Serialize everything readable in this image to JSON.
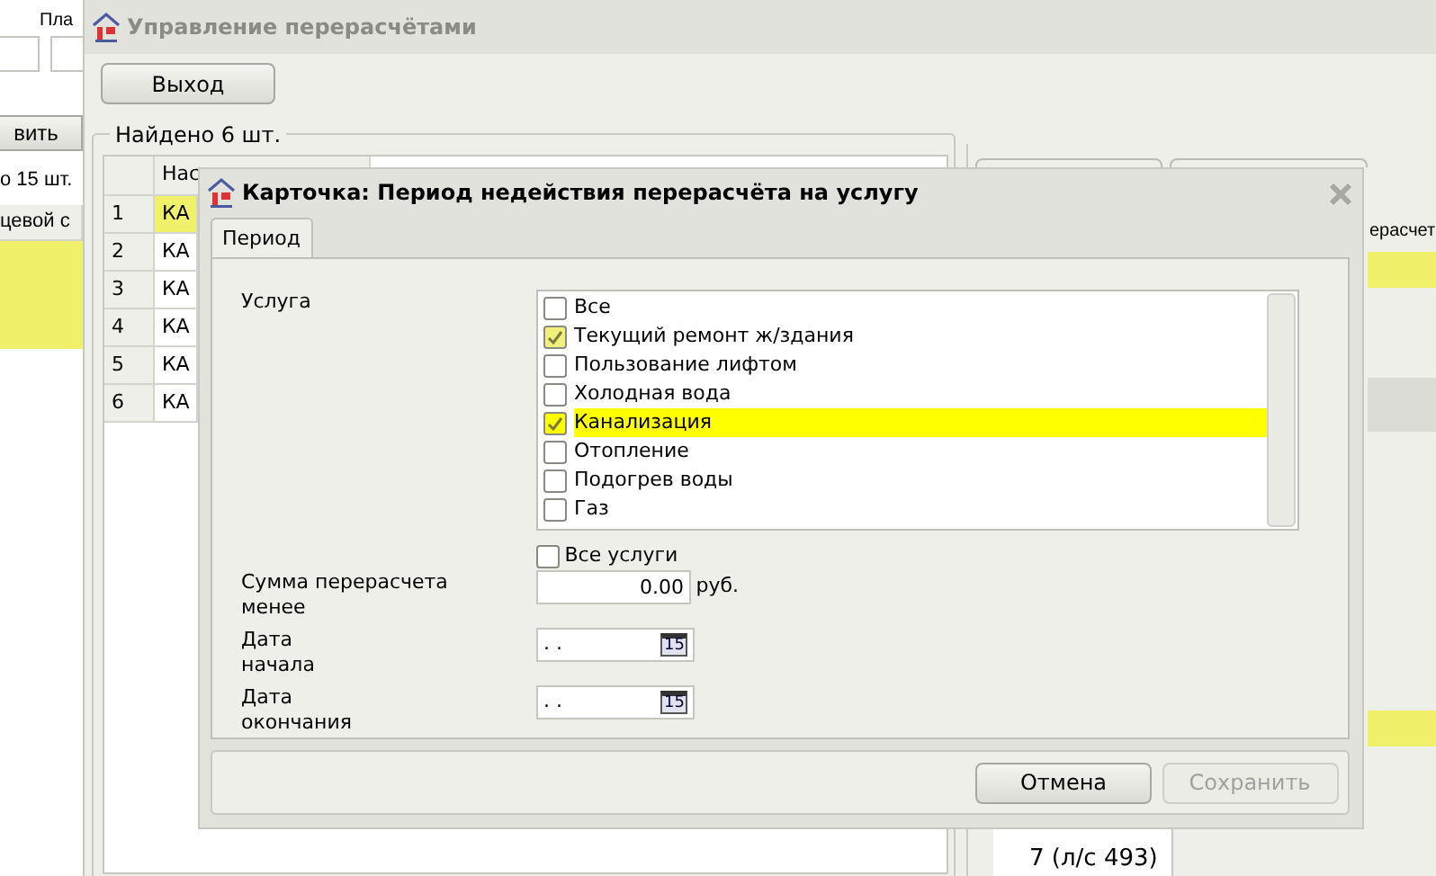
{
  "back_window": {
    "label": "Пла",
    "button": "вить",
    "count": "о 15 шт.",
    "column": "цевой с"
  },
  "main_window": {
    "title": "Управление перерасчётами",
    "exit_button": "Выход",
    "found": "Найдено 6 шт.",
    "table": {
      "columns": [
        "Нас"
      ],
      "rows": [
        {
          "number": "1",
          "cell": "КА",
          "selected": true
        },
        {
          "number": "2",
          "cell": "КА",
          "selected": false
        },
        {
          "number": "3",
          "cell": "КА",
          "selected": false
        },
        {
          "number": "4",
          "cell": "КА",
          "selected": false
        },
        {
          "number": "5",
          "cell": "КА",
          "selected": false
        },
        {
          "number": "6",
          "cell": "КА",
          "selected": false
        }
      ]
    },
    "right_panel": {
      "label": "ерасчет",
      "tree": [
        "7 (л/с 493)"
      ]
    }
  },
  "dialog": {
    "title": "Карточка: Период недействия перерасчёта на услугу",
    "tabs": [
      {
        "label": "Период",
        "selected": true
      }
    ],
    "service_label": "Услуга",
    "services": [
      {
        "label": "Все",
        "checked": false,
        "selected": false
      },
      {
        "label": "Текущий ремонт ж/здания",
        "checked": true,
        "selected": false
      },
      {
        "label": "Пользование лифтом",
        "checked": false,
        "selected": false
      },
      {
        "label": "Холодная вода",
        "checked": false,
        "selected": false
      },
      {
        "label": "Канализация",
        "checked": true,
        "selected": true
      },
      {
        "label": "Отопление",
        "checked": false,
        "selected": false
      },
      {
        "label": "Подогрев воды",
        "checked": false,
        "selected": false
      },
      {
        "label": "Газ",
        "checked": false,
        "selected": false
      }
    ],
    "all_services": {
      "label": "Все услуги",
      "checked": false
    },
    "sum": {
      "label": "Сумма перерасчета\nменее",
      "value": "0.00",
      "unit": "руб."
    },
    "dates": [
      {
        "label": "Дата\nначала",
        "value": ". .",
        "calendar": "15"
      },
      {
        "label": "Дата\nокончания",
        "value": ". .",
        "calendar": "15"
      }
    ],
    "buttons": [
      {
        "label": "Отмена",
        "disabled": false
      },
      {
        "label": "Сохранить",
        "disabled": true
      }
    ]
  }
}
